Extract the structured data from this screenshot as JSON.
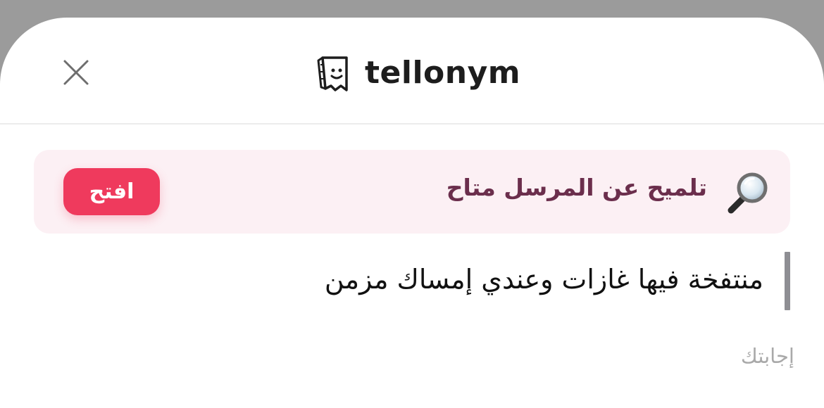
{
  "header": {
    "brand_name": "tellonym",
    "close_icon": "close-icon",
    "logo_icon": "tellonym-logo-icon"
  },
  "hint": {
    "icon": "magnifying-glass-icon",
    "text": "تلميح عن المرسل متاح",
    "button_label": "افتح"
  },
  "question": {
    "text": "منتفخة فيها غازات وعندي إمساك مزمن"
  },
  "answer": {
    "placeholder": "إجابتك",
    "value": ""
  },
  "colors": {
    "accent": "#ef3a5d",
    "hint_bg": "#fcf0f4",
    "hint_text": "#6b2e4c"
  }
}
